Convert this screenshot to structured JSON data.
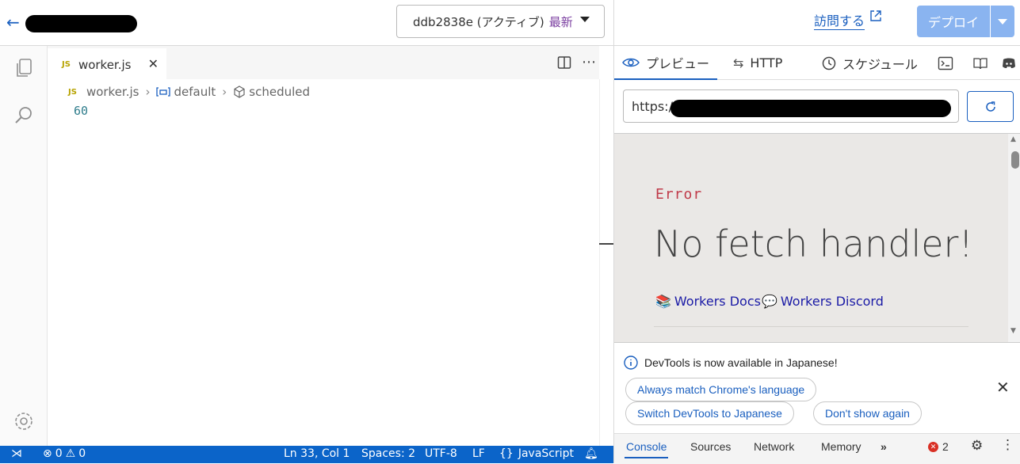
{
  "header": {
    "version": "ddb2838e (アクティブ)",
    "version_tag": "最新",
    "visit_label": "訪問する",
    "deploy_label": "デプロイ"
  },
  "editor": {
    "tab_badge": "JS",
    "tab_label": "worker.js",
    "breadcrumb": [
      "worker.js",
      "default",
      "scheduled"
    ],
    "code_line": "60"
  },
  "statusbar": {
    "errors": "0",
    "warnings": "0",
    "position": "Ln 33, Col 1",
    "spaces": "Spaces: 2",
    "encoding": "UTF-8",
    "eol": "LF",
    "language": "JavaScript"
  },
  "preview": {
    "tabs": [
      "プレビュー",
      "HTTP",
      "スケジュール"
    ],
    "url_prefix": "https:/",
    "error_label": "Error",
    "error_title": "No fetch handler!",
    "links": [
      "Workers Docs",
      "Workers Discord"
    ]
  },
  "devtools": {
    "info": "DevTools is now available in Japanese!",
    "buttons": [
      "Always match Chrome's language",
      "Switch DevTools to Japanese",
      "Don't show again"
    ],
    "tabs": [
      "Console",
      "Sources",
      "Network",
      "Memory"
    ],
    "error_count": "2"
  },
  "colors": {
    "accent": "#1a5fbf",
    "statusbar": "#0b64c9",
    "deploy": "#8ab4f0",
    "error": "#c03b4a"
  }
}
